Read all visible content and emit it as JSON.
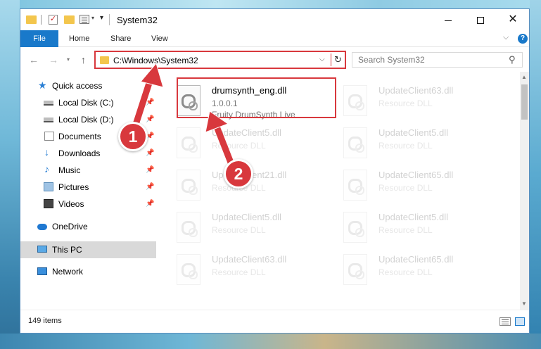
{
  "window": {
    "title": "System32",
    "minimize_label": "",
    "close_label": "✕"
  },
  "ribbon": {
    "file": "File",
    "home": "Home",
    "share": "Share",
    "view": "View"
  },
  "navigation": {
    "address": "C:\\Windows\\System32",
    "search_placeholder": "Search System32"
  },
  "sidebar": {
    "items": [
      {
        "label": "Quick access",
        "icon": "star-icon"
      },
      {
        "label": "Local Disk (C:)",
        "icon": "disk-icon"
      },
      {
        "label": "Local Disk (D:)",
        "icon": "disk-icon"
      },
      {
        "label": "Documents",
        "icon": "document-icon"
      },
      {
        "label": "Downloads",
        "icon": "download-icon"
      },
      {
        "label": "Music",
        "icon": "music-icon"
      },
      {
        "label": "Pictures",
        "icon": "pictures-icon"
      },
      {
        "label": "Videos",
        "icon": "video-icon"
      },
      {
        "label": "OneDrive",
        "icon": "cloud-icon"
      },
      {
        "label": "This PC",
        "icon": "computer-icon",
        "selected": true
      },
      {
        "label": "Network",
        "icon": "network-icon"
      }
    ]
  },
  "files": {
    "highlighted": {
      "name": "drumsynth_eng.dll",
      "version": "1.0.0.1",
      "description": "Fruity DrumSynth Live"
    },
    "background": [
      {
        "name": "UpdateClient63.dll",
        "type": "Resource DLL"
      },
      {
        "name": "UpdateClient5.dll",
        "type": "Resource DLL"
      },
      {
        "name": "UpdateClient5.dll",
        "type": "Resource DLL"
      },
      {
        "name": "UpdateClient21.dll",
        "type": "Resource DLL"
      },
      {
        "name": "UpdateClient65.dll",
        "type": "Resource DLL"
      },
      {
        "name": "UpdateClient5.dll",
        "type": "Resource DLL"
      },
      {
        "name": "UpdateClient5.dll",
        "type": "Resource DLL"
      },
      {
        "name": "UpdateClient63.dll",
        "type": "Resource DLL"
      },
      {
        "name": "UpdateClient65.dll",
        "type": "Resource DLL"
      }
    ]
  },
  "status": {
    "item_count": "149 items"
  },
  "annotations": {
    "step1": "1",
    "step2": "2",
    "color": "#d8383d"
  }
}
